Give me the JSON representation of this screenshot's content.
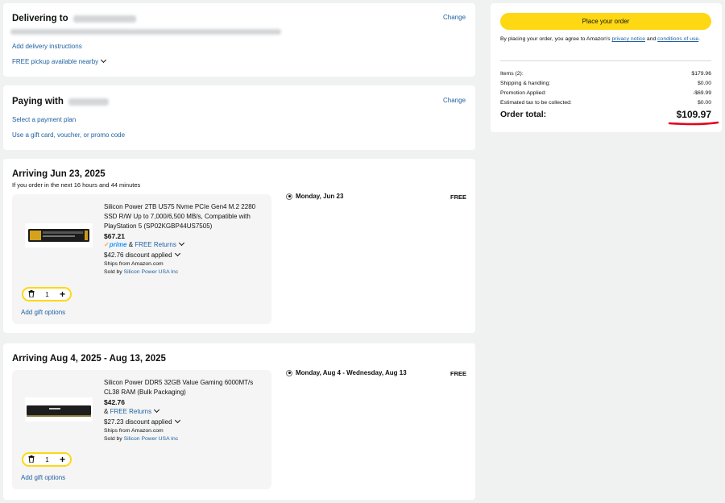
{
  "delivery": {
    "title": "Delivering to",
    "change": "Change",
    "instructions": "Add delivery instructions",
    "pickup": "FREE pickup available nearby"
  },
  "payment": {
    "title": "Paying with",
    "change": "Change",
    "plan": "Select a payment plan",
    "gift": "Use a gift card, voucher, or promo code"
  },
  "shipments": [
    {
      "arriving": "Arriving Jun 23, 2025",
      "order_within": "If you order in the next 16 hours and 44 minutes",
      "option_date": "Monday, Jun 23",
      "option_price": "FREE",
      "product": {
        "title": "Silicon Power 2TB US75 Nvme PCIe Gen4 M.2 2280 SSD R/W Up to 7,000/6,500 MB/s, Compatible with PlayStation 5 (SP02KGBP44US7505)",
        "price": "$67.21",
        "prime": "prime",
        "returns": "FREE Returns",
        "discount": "$42.76 discount applied",
        "ships_from": "Ships from Amazon.com",
        "sold_by_label": "Sold by",
        "sold_by": "Silicon Power USA Inc",
        "quantity": "1",
        "gift": "Add gift options"
      }
    },
    {
      "arriving": "Arriving Aug 4, 2025 - Aug 13, 2025",
      "option_date": "Monday, Aug 4 - Wednesday, Aug 13",
      "option_price": "FREE",
      "product": {
        "title": "Silicon Power DDR5 32GB Value Gaming 6000MT/s CL38 RAM (Bulk Packaging)",
        "price": "$42.76",
        "returns": "FREE Returns",
        "discount": "$27.23 discount applied",
        "ships_from": "Ships from Amazon.com",
        "sold_by_label": "Sold by",
        "sold_by": "Silicon Power USA Inc",
        "quantity": "1",
        "gift": "Add gift options"
      }
    }
  ],
  "summary": {
    "place_order": "Place your order",
    "agree_prefix": "By placing your order, you agree to Amazon's",
    "privacy": "privacy notice",
    "and": "and",
    "conditions": "conditions of use",
    "rows": [
      {
        "label": "Items (2):",
        "value": "$179.96"
      },
      {
        "label": "Shipping & handling:",
        "value": "$0.00"
      },
      {
        "label": "Promotion Applied:",
        "value": "-$69.99"
      },
      {
        "label": "Estimated tax to be collected:",
        "value": "$0.00"
      }
    ],
    "total_label": "Order total:",
    "total_value": "$109.97"
  },
  "colors": {
    "accent": "#ffd814",
    "link": "#2162a1",
    "prime": "#1a98ff",
    "underline": "#e3001b"
  }
}
